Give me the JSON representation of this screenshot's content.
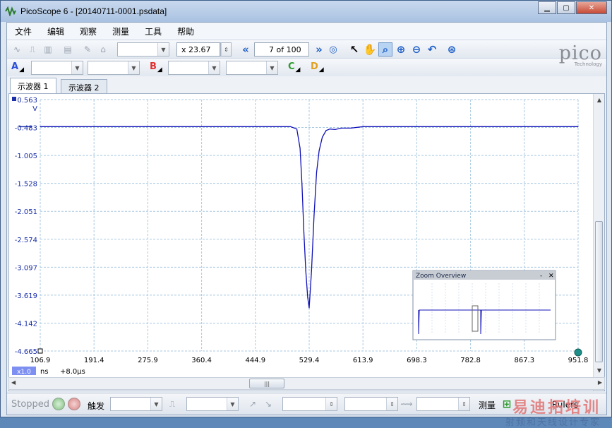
{
  "window": {
    "title": "PicoScope 6 - [20140711-0001.psdata]",
    "minimize_glyph": "▁",
    "maximize_glyph": "▢",
    "close_glyph": "✕"
  },
  "menu": [
    "文件",
    "编辑",
    "观察",
    "测量",
    "工具",
    "帮助"
  ],
  "toolbar": {
    "zoom_value": "x 23.67",
    "buffer_position": "7 of 100"
  },
  "channels": [
    {
      "label": "A",
      "color": "#2b4fd8"
    },
    {
      "label": "B",
      "color": "#e03030"
    },
    {
      "label": "C",
      "color": "#2f9a2f"
    },
    {
      "label": "D",
      "color": "#e0a020"
    }
  ],
  "logo": {
    "brand": "pico",
    "sub": "Technology"
  },
  "tabs": [
    "示波器 1",
    "示波器 2"
  ],
  "scope": {
    "trace_color": "#1010b8",
    "y_unit": "V",
    "x_unit": "ns",
    "x_scale_badge": "x1.0",
    "x_offset": "+8.0μs",
    "overview_title": "Zoom Overview",
    "overview_minimize": "-",
    "overview_close": "✕"
  },
  "status": {
    "state": "Stopped",
    "trigger_label": "触发",
    "measure_label": "测量",
    "rulers_label": "Rulers"
  },
  "watermark": {
    "line1": "易迪拓培训",
    "line2": "射频和天线设计专家"
  },
  "chart_data": {
    "type": "line",
    "title": "",
    "ylabel": "V",
    "xlabel": "ns",
    "y_ticks": [
      "0.563",
      "-0.483",
      "-1.005",
      "-1.528",
      "-2.051",
      "-2.574",
      "-3.097",
      "-3.619",
      "-4.142",
      "-4.665"
    ],
    "x_ticks": [
      "106.9",
      "191.4",
      "275.9",
      "360.4",
      "444.9",
      "529.4",
      "613.9",
      "698.3",
      "782.8",
      "867.3",
      "951.8"
    ],
    "ylim": [
      -4.665,
      0.563
    ],
    "xlim": [
      106.9,
      951.8
    ],
    "grid": true,
    "series": [
      {
        "x": [
          106.9,
          200,
          300,
          400,
          500,
          510,
          515,
          518,
          521,
          524,
          527,
          529.4,
          533,
          537,
          541,
          545,
          550,
          556,
          562,
          570,
          580,
          595,
          613.9,
          650,
          700,
          800,
          900,
          951.8
        ],
        "y": [
          0.0,
          0.0,
          0.0,
          0.0,
          0.0,
          -0.05,
          -0.45,
          -1.2,
          -2.2,
          -3.0,
          -3.55,
          -3.77,
          -3.0,
          -1.85,
          -0.95,
          -0.5,
          -0.22,
          -0.08,
          -0.05,
          -0.06,
          -0.03,
          -0.03,
          0.0,
          0.0,
          0.0,
          0.0,
          0.0,
          0.0
        ]
      }
    ]
  }
}
